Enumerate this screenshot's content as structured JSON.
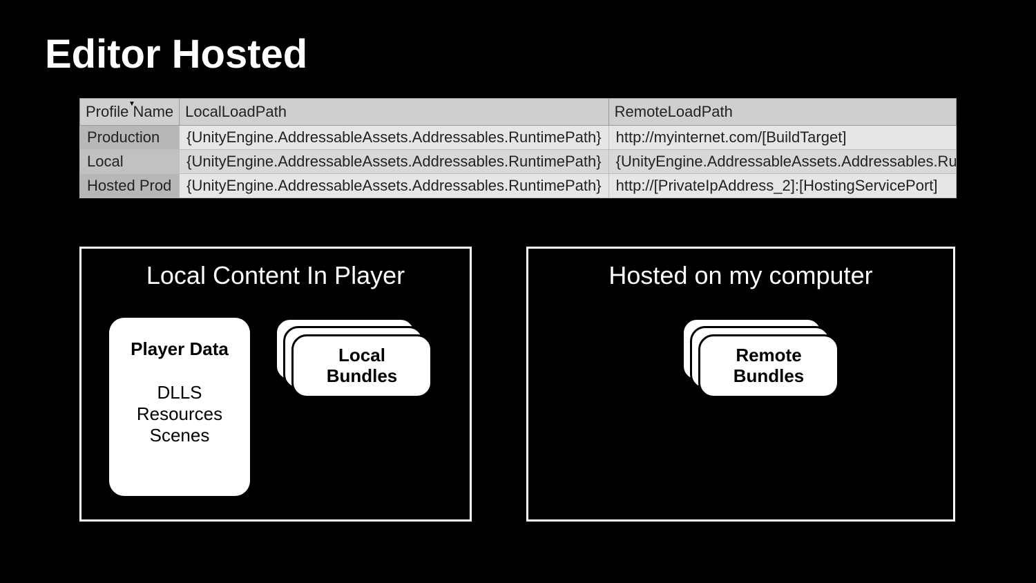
{
  "title": "Editor Hosted",
  "table": {
    "headers": {
      "name": "Profile Name",
      "local": "LocalLoadPath",
      "remote": "RemoteLoadPath"
    },
    "rows": [
      {
        "name": "Production",
        "local": "{UnityEngine.AddressableAssets.Addressables.RuntimePath}",
        "remote": "http://myinternet.com/[BuildTarget]"
      },
      {
        "name": "Local",
        "local": "{UnityEngine.AddressableAssets.Addressables.RuntimePath}",
        "remote": "{UnityEngine.AddressableAssets.Addressables.Runtim"
      },
      {
        "name": "Hosted Prod",
        "local": "{UnityEngine.AddressableAssets.Addressables.RuntimePath}",
        "remote": "http://[PrivateIpAddress_2]:[HostingServicePort]"
      }
    ]
  },
  "panels": {
    "left": {
      "title": "Local Content In Player",
      "playerCard": {
        "title": "Player Data",
        "line1": "DLLS",
        "line2": "Resources",
        "line3": "Scenes"
      },
      "stackLabelLine1": "Local",
      "stackLabelLine2": "Bundles"
    },
    "right": {
      "title": "Hosted on my computer",
      "stackLabelLine1": "Remote",
      "stackLabelLine2": "Bundles"
    }
  }
}
